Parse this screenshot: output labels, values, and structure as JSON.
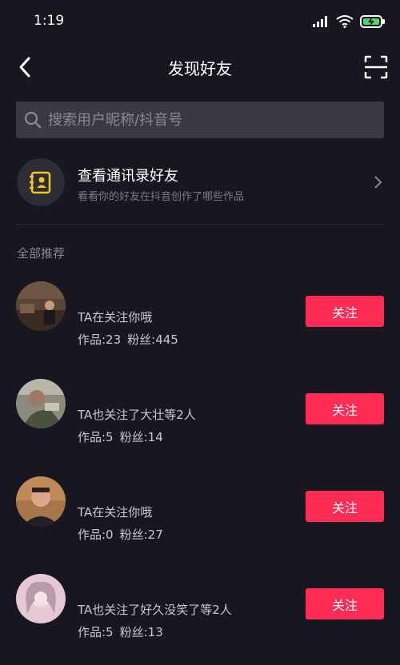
{
  "status": {
    "time": "1:19"
  },
  "header": {
    "title": "发现好友"
  },
  "search": {
    "placeholder": "搜索用户昵称/抖音号",
    "value": ""
  },
  "contacts": {
    "title": "查看通讯录好友",
    "subtitle": "看看你的好友在抖音创作了哪些作品"
  },
  "section_label": "全部推荐",
  "recommendations": [
    {
      "relation": "TA在关注你哦",
      "works": "作品:23",
      "fans": "粉丝:445",
      "follow_label": "关注"
    },
    {
      "relation": "TA也关注了大壮等2人",
      "works": "作品:5",
      "fans": "粉丝:14",
      "follow_label": "关注"
    },
    {
      "relation": "TA在关注你哦",
      "works": "作品:0",
      "fans": "粉丝:27",
      "follow_label": "关注"
    },
    {
      "relation": "TA也关注了好久没笑了等2人",
      "works": "作品:5",
      "fans": "粉丝:13",
      "follow_label": "关注"
    }
  ],
  "colors": {
    "background": "#171722",
    "accent": "#fe2c55",
    "search_bg": "#3a3a45",
    "contacts_icon": "#f5c518"
  },
  "icons": [
    "signal-icon",
    "wifi-icon",
    "battery-charging-icon",
    "back-arrow-icon",
    "scan-icon",
    "search-icon",
    "contacts-book-icon",
    "chevron-right-icon"
  ]
}
